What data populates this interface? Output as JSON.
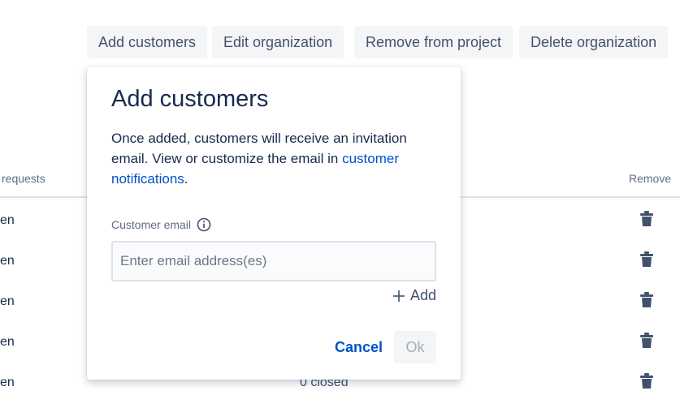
{
  "toolbar": {
    "add_customers": "Add customers",
    "edit_organization": "Edit organization",
    "remove_from_project": "Remove from project",
    "delete_organization": "Delete organization"
  },
  "table": {
    "headers": {
      "requests": "requests",
      "remove": "Remove"
    },
    "rows": [
      {
        "status": "en"
      },
      {
        "status": "en"
      },
      {
        "status": "en"
      },
      {
        "status": "en"
      },
      {
        "status": "en",
        "closed": "0 closed"
      }
    ]
  },
  "dialog": {
    "title": "Add customers",
    "description_prefix": "Once added, customers will receive an invitation email. View or customize the email in ",
    "description_link": "customer notifications",
    "description_suffix": ".",
    "field_label": "Customer email",
    "email_placeholder": "Enter email address(es)",
    "add_label": "Add",
    "cancel_label": "Cancel",
    "ok_label": "Ok"
  },
  "colors": {
    "link": "#0052cc",
    "text": "#172b4d",
    "muted": "#5e6c84",
    "button_bg": "#f4f5f7",
    "disabled_text": "#a5adba"
  },
  "icons": {
    "info": "info-icon",
    "plus": "plus-icon",
    "trash": "trash-icon"
  }
}
